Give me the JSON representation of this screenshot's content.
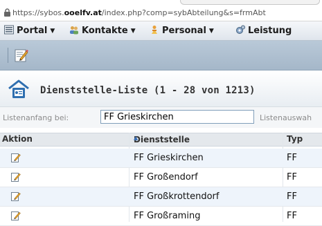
{
  "browser": {
    "url_prefix": "https://sybos.",
    "url_domain": "ooelfv.at",
    "url_suffix": "/index.php?comp=sybAbteilung&s=frmAbt"
  },
  "menu": {
    "items": [
      {
        "label": "Portal",
        "icon": "portal-icon"
      },
      {
        "label": "Kontakte",
        "icon": "contacts-icon"
      },
      {
        "label": "Personal",
        "icon": "personnel-icon"
      },
      {
        "label": "Leistung",
        "icon": "service-icon"
      }
    ]
  },
  "page": {
    "title": "Dienststelle-Liste (1 - 28 von 1213)"
  },
  "filter": {
    "start_label": "Listenanfang bei:",
    "start_value": "FF Grieskirchen",
    "selection_label": "Listenauswah"
  },
  "table": {
    "headers": {
      "action": "Aktion",
      "unit": "Dienststelle",
      "type": "Typ"
    },
    "sort_indicator": "▲",
    "rows": [
      {
        "name": "FF Grieskirchen",
        "type": "FF"
      },
      {
        "name": "FF Großendorf",
        "type": "FF"
      },
      {
        "name": "FF Großkrottendorf",
        "type": "FF"
      },
      {
        "name": "FF Großraming",
        "type": "FF"
      }
    ]
  },
  "colors": {
    "accent": "#3b6fb6",
    "row_highlight": "#eef4fb",
    "toolbar": "#b9c9d8"
  }
}
